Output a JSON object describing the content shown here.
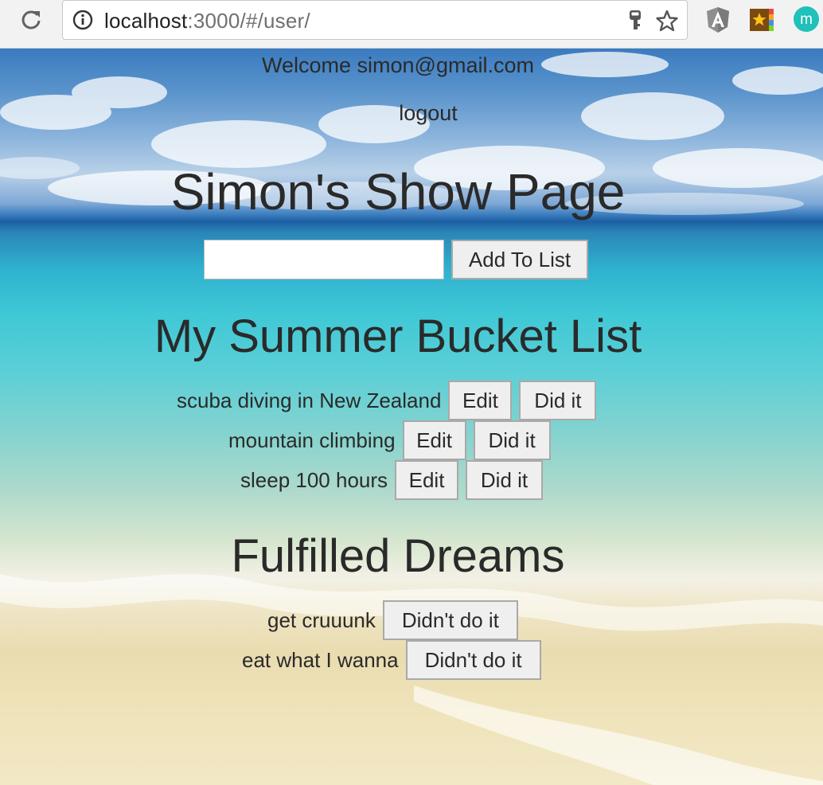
{
  "browser": {
    "url_host": "localhost",
    "url_rest": ":3000/#/user/"
  },
  "header": {
    "welcome": "Welcome simon@gmail.com",
    "logout": "logout"
  },
  "page": {
    "title": "Simon's Show Page",
    "add_input_value": "",
    "add_button": "Add To List"
  },
  "bucket_list": {
    "title": "My Summer Bucket List",
    "items": [
      {
        "label": "scuba diving in New Zealand",
        "edit": "Edit",
        "done": "Did it"
      },
      {
        "label": "mountain climbing",
        "edit": "Edit",
        "done": "Did it"
      },
      {
        "label": "sleep 100 hours",
        "edit": "Edit",
        "done": "Did it"
      }
    ]
  },
  "fulfilled": {
    "title": "Fulfilled Dreams",
    "items": [
      {
        "label": "get cruuunk",
        "undo": "Didn't do it"
      },
      {
        "label": "eat what I wanna",
        "undo": "Didn't do it"
      }
    ]
  },
  "colors": {
    "text": "#2a2a2a",
    "button_bg": "#efefef",
    "button_border": "#a9a9a9",
    "chrome_bg": "#f2f2f2"
  },
  "icons": {
    "reload": "reload-icon",
    "info": "info-icon",
    "key": "key-icon",
    "star": "star-icon",
    "angular_extension": "angular-extension-icon",
    "bookmark_extension": "bookmark-extension-icon",
    "m_extension": "m-extension-icon"
  }
}
